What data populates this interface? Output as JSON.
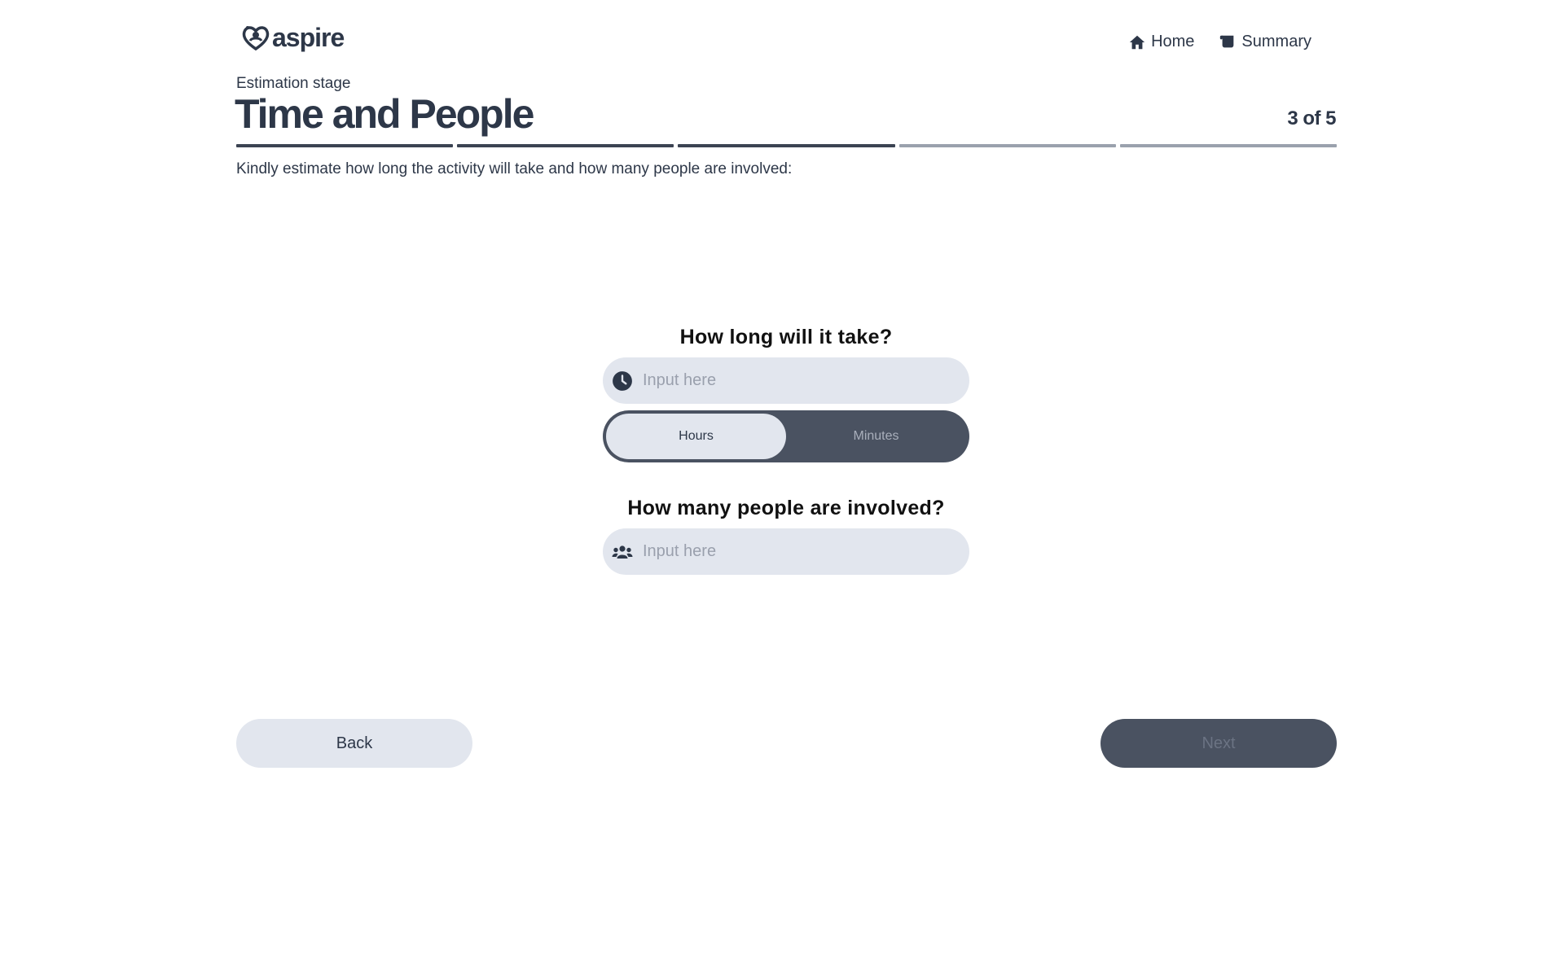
{
  "header": {
    "logo_text": "aspire",
    "nav": {
      "home_label": "Home",
      "summary_label": "Summary"
    }
  },
  "stage": {
    "label": "Estimation stage",
    "title": "Time and People",
    "step_text": "3 of 5",
    "current_step": 3,
    "total_steps": 5
  },
  "instructions": "Kindly estimate how long the activity will take and how many people are involved:",
  "form": {
    "duration": {
      "question": "How long will it take?",
      "placeholder": "Input here",
      "value": "",
      "icon": "clock-icon",
      "units": [
        "Hours",
        "Minutes"
      ],
      "selected_unit": "Hours"
    },
    "people": {
      "question": "How many people are involved?",
      "placeholder": "Input here",
      "value": "",
      "icon": "people-icon"
    }
  },
  "footer": {
    "back_label": "Back",
    "next_label": "Next",
    "next_disabled": true
  },
  "colors": {
    "primary_dark": "#3b4352",
    "button_dark": "#4a5261",
    "input_bg": "#e2e6ee",
    "text": "#2d3748"
  }
}
